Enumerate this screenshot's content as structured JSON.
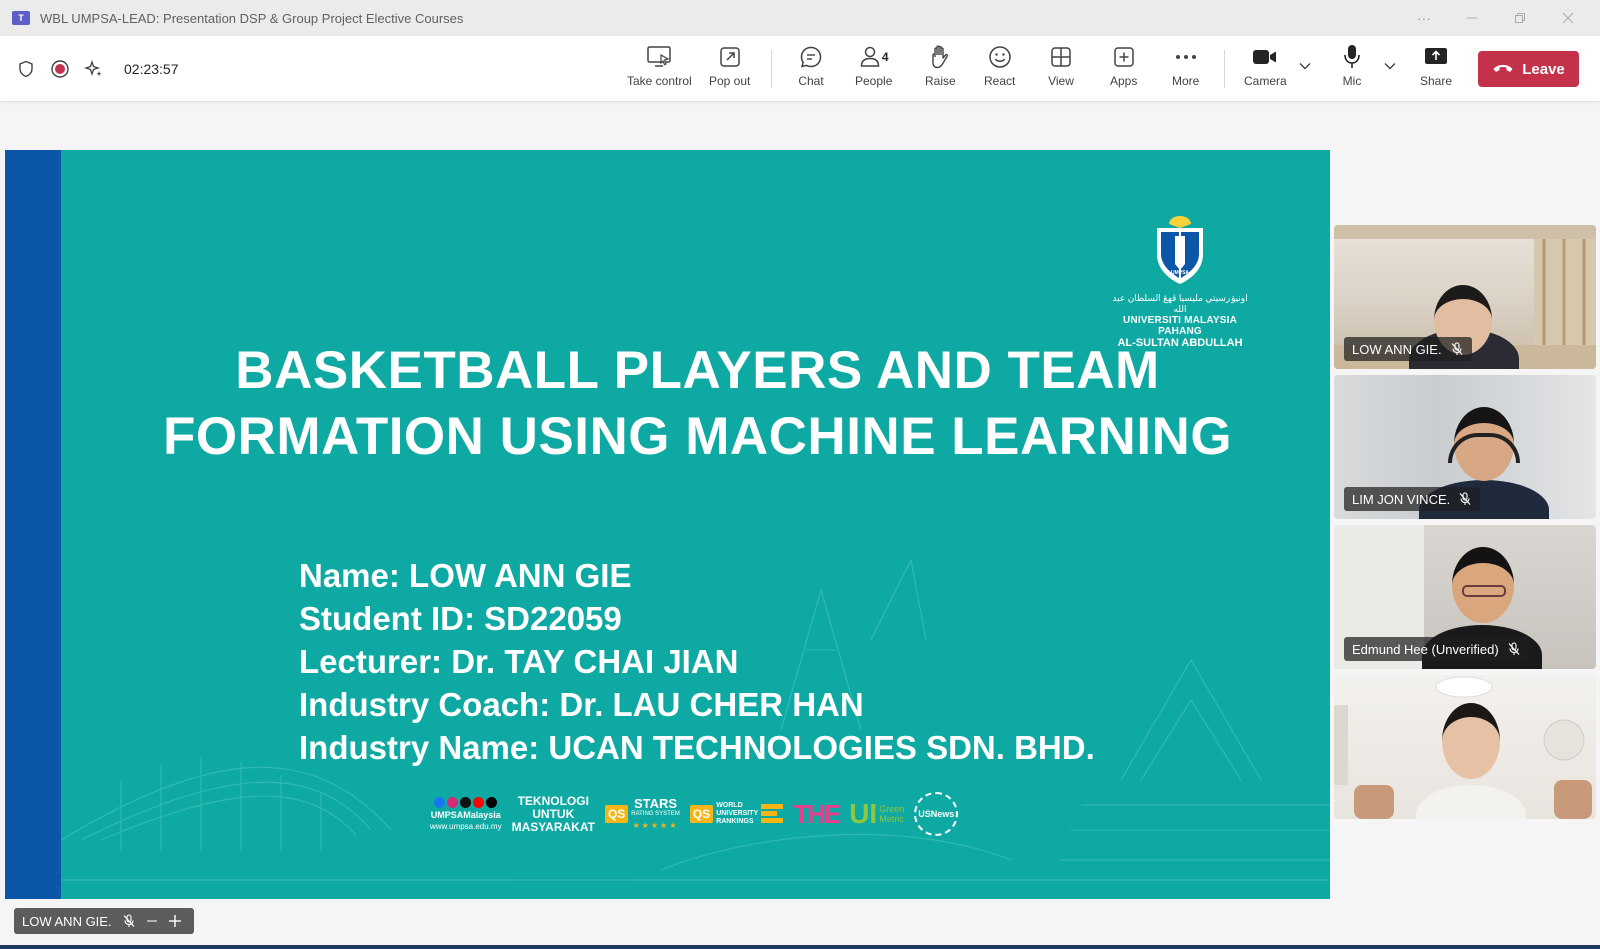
{
  "window": {
    "title": "WBL UMPSA-LEAD: Presentation DSP & Group Project Elective Courses",
    "app_icon": "teams-icon",
    "more_label": "···"
  },
  "toolbar": {
    "timer": "02:23:57",
    "take_control": "Take control",
    "pop_out": "Pop out",
    "chat": "Chat",
    "people": "People",
    "people_count": "4",
    "raise": "Raise",
    "react": "React",
    "view": "View",
    "apps": "Apps",
    "more": "More",
    "camera": "Camera",
    "mic": "Mic",
    "share": "Share",
    "leave": "Leave"
  },
  "slide": {
    "uni_arabic": "اونيۏرسيتي مليسيا ڤهڠ السلطان عبد الله",
    "uni_name_line1": "UNIVERSITI MALAYSIA PAHANG",
    "uni_name_line2": "AL-SULTAN ABDULLAH",
    "logo_text": "UMPSA",
    "title_line1": "BASKETBALL PLAYERS AND TEAM",
    "title_line2": "FORMATION USING MACHINE LEARNING",
    "info": [
      "Name: LOW ANN GIE",
      "Student ID: SD22059",
      "Lecturer: Dr. TAY CHAI JIAN",
      "Industry Coach: Dr. LAU CHER HAN",
      "Industry Name: UCAN TECHNOLOGIES SDN. BHD."
    ],
    "footer": {
      "social_handle": "UMPSAMalaysia",
      "website": "www.umpsa.edu.my",
      "tagline1": "TEKNOLOGI",
      "tagline2": "UNTUK",
      "tagline3": "MASYARAKAT",
      "qs": "QS",
      "stars": "STARS",
      "stars_sub": "RATING SYSTEM",
      "wur1": "WORLD",
      "wur2": "UNIVERSITY",
      "wur3": "RANKINGS",
      "the": "THE",
      "ui": "UI",
      "green": "Green",
      "metric": "Metric",
      "usnews": "USNews"
    }
  },
  "participants": [
    {
      "name": "LOW ANN GIE."
    },
    {
      "name": "LIM JON VINCE."
    },
    {
      "name": "Edmund Hee (Unverified)"
    },
    {
      "name": ""
    }
  ],
  "bottom_label": {
    "name": "LOW ANN GIE."
  },
  "colors": {
    "slide_bg": "#0fa9a3",
    "slide_bar": "#0c56a8",
    "leave": "#c4314b",
    "record": "#c4314b"
  }
}
